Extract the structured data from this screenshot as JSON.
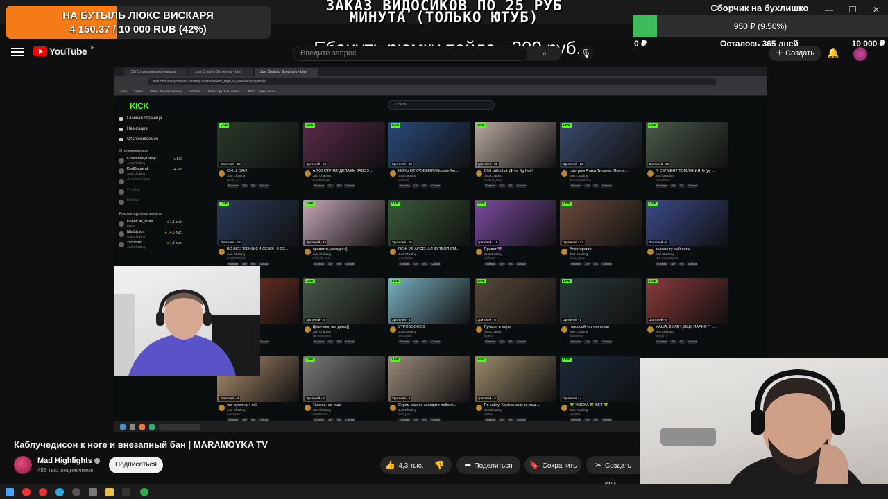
{
  "donation": {
    "title": "НА БУТЫЛЬ ЛЮКС ВИСКАРЯ",
    "progress_text": "4 150.37 / 10 000 RUB (42%)",
    "fraction": 0.42,
    "color": "#f57a18"
  },
  "order": {
    "title": "ЗАКАЗ ВИДОСИКОВ ПО 25 РУБ МИНУТА (ТОЛЬКО ЮТУБ)",
    "subtitle": "Ебануть рюмку пойла - 300 руб."
  },
  "goal": {
    "title": "Сборчик на бухлишко",
    "progress_text": "950 ₽ (9.50%)",
    "fraction": 0.095,
    "min_label": "0 ₽",
    "remaining_label": "Осталось 365 дней",
    "max_label": "10 000 ₽",
    "color": "#3dba5a"
  },
  "window_controls": [
    "—",
    "❐",
    "✕"
  ],
  "youtube": {
    "logo_text": "YouTube",
    "country": "DE",
    "search_placeholder": "Введите запрос",
    "create_label": "Создать",
    "accent_color": "#ff0000"
  },
  "inner_browser": {
    "tabs": [
      "(15) Отслеживаемые каналы",
      "Just Chatting Streaming - Live",
      "Just Chatting Streaming - Live"
    ],
    "url": "kick.com/category/just-chatting?sort=viewers_high_to_low&languages=ru",
    "bookmarks": [
      "Kick",
      "Twitch",
      "Stake: Онлайн-казино",
      "YouTube",
      "Спорт: футбол, хокке...",
      "ЕГЭ — игры, кино..."
    ]
  },
  "kick": {
    "logo": "KICK",
    "search_placeholder": "Поиск",
    "nav": [
      "Главная страница",
      "Навигация",
      "Отслеживаемое"
    ],
    "following_title": "Отслеживаемое",
    "following": [
      {
        "name": "KhovanskyToday",
        "category": "Just Chatting",
        "viewers": "539",
        "online": true
      },
      {
        "name": "DedBagnyuk",
        "category": "Just Chatting",
        "viewers": "248",
        "online": true
      },
      {
        "name": "Anomalodjam",
        "category": "",
        "viewers": "",
        "online": false
      },
      {
        "name": "Prodinn",
        "category": "",
        "viewers": "",
        "online": false
      },
      {
        "name": "BBistro",
        "category": "",
        "viewers": "",
        "online": false
      }
    ],
    "recommended_title": "Рекомендуемые каналы",
    "recommended": [
      {
        "name": "PokerOK_strea...",
        "category": "Poker",
        "viewers": "1,1 тыс.",
        "online": true
      },
      {
        "name": "Maddyson",
        "category": "Just Chatting",
        "viewers": "14,6 тыс.",
        "online": true
      },
      {
        "name": "zxcursed",
        "category": "Just Chatting",
        "viewers": "1,8 тыс.",
        "online": true
      }
    ],
    "live_label": "LIVE",
    "category": "Just Chatting",
    "tags": [
      "Russian",
      "18+",
      "IRL",
      "Casual"
    ],
    "streams": [
      {
        "title": "CHILL DAY!",
        "user": "Berlin_a",
        "viewers": "Зрителей - 55"
      },
      {
        "title": "АЛКО СТРИМ! ДЕЛАЕМ ЗАВОЗ ...",
        "user": "BADSCLUB",
        "viewers": "Зрителей - 55"
      },
      {
        "title": "НОЧЬ ОТКРОВЕНИЙ/donate !bo...",
        "user": "milestpl",
        "viewers": "Зрителей - 43"
      },
      {
        "title": "Chill with chat ✨ for ftg free!",
        "user": "Yecfcal_chan",
        "viewers": "Зрителей - 30"
      },
      {
        "title": "смотрим Атака Титанов: После...",
        "user": "TrueGrandmics",
        "viewers": "Зрителей - 22"
      },
      {
        "title": "⅞ СЕГМЕНТ ТОМЛЕНИЯ ⅞ (ру ...",
        "user": "Ivandithan",
        "viewers": "Зрителей - 21"
      },
      {
        "title": "ВО ВСЕ ТЯЖКИЕ 4 СЕЗОН 8 СЕ...",
        "user": "serdel587bek",
        "viewers": "Зрителей - 15"
      },
      {
        "title": "приветик, заходи :))",
        "user": "Kolibail_444",
        "viewers": "Зрителей - 15"
      },
      {
        "title": "ПСЖ VS АРСЕНАЛ ФУТБОЛ СМ...",
        "user": "voledcelitis",
        "viewers": "Зрителей - 15"
      },
      {
        "title": "Привет 💜",
        "user": "evilberry",
        "viewers": "Зрителей - 16"
      },
      {
        "title": "Алкотерапия",
        "user": "abce_neve",
        "viewers": "Зрителей - 13"
      },
      {
        "title": "велкам ту май хата",
        "user": "Maroonnaatty84",
        "viewers": "Зрителей - 8"
      },
      {
        "title": "...ности",
        "user": "",
        "viewers": ""
      },
      {
        "title": "Девачьки, мы дома))",
        "user": "sahasova888",
        "viewers": "Зрителей - 8"
      },
      {
        "title": "УТРОБОООО0",
        "user": "otrubs888",
        "viewers": "Зрителей - 8"
      },
      {
        "title": "Лучшая в мире",
        "user": "lilyakoj",
        "viewers": "Зрителей - 8"
      },
      {
        "title": "голосовй чат некто ми",
        "user": "doublesky",
        "viewers": "Зрителей - 5"
      },
      {
        "title": "МАША, 20 ЛЕТ, ИЩУ ПАРНЯ ** l...",
        "user": "MaryaTV",
        "viewers": "Зрителей - 4"
      },
      {
        "title": "чат рулетка + кс2",
        "user": "nozaladon",
        "viewers": "Зрителей - 4"
      },
      {
        "title": "Такси и чат еще",
        "user": "KUCENIKA",
        "viewers": "Зрителей - 4"
      },
      {
        "title": "Стрим разнос заходите поболт...",
        "user": "kirill_pnnl",
        "viewers": "Зрителей - 7"
      },
      {
        "title": "По кайту. Крутим кзжк за ваш ...",
        "user": "v0006",
        "viewers": "Зрителей - 4"
      },
      {
        "title": "🍀 VODKA 🍀 BET 🍀",
        "user": "Egs888",
        "viewers": "Зрителей - 4"
      }
    ]
  },
  "video": {
    "title": "Каблучедисон к ноге и внезапный бан | MARAMOYKA TV",
    "channel": "Mad Highlights",
    "subscribers": "456 тыс. подписчиков",
    "subscribe_label": "Подписаться",
    "likes": "4,3 тыс.",
    "share_label": "Поделиться",
    "save_label": "Сохранить",
    "clip_label": "Создать кли..."
  },
  "icons": {
    "menu": "menu-icon",
    "mic": "mic-icon",
    "bell": "bell-icon",
    "like": "thumbs-up-icon",
    "dislike": "thumbs-down-icon",
    "share": "share-icon",
    "save": "bookmark-icon",
    "clip": "scissors-icon"
  }
}
